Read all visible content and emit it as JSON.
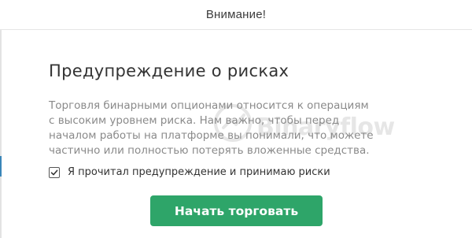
{
  "header": {
    "title": "Внимание!"
  },
  "content": {
    "heading": "Предупреждение о рисках",
    "body_lines": [
      "Торговля бинарными опционами относится к операциям",
      "с высоким уровнем риска. Нам важно, чтобы перед",
      "началом работы на платформе вы понимали, что можете",
      "частично или полностью потерять вложенные средства."
    ],
    "watermark": "Binaryflow"
  },
  "agreement": {
    "checked": true,
    "label": "Я прочитал предупреждение и принимаю риски"
  },
  "actions": {
    "start_label": "Начать торговать"
  },
  "colors": {
    "primary_button": "#2ea569",
    "heading_text": "#333333",
    "body_text": "#8a8a8a",
    "left_edge_accent": "#3a86b8"
  },
  "icons": {
    "checkbox": "check-icon",
    "watermark_logo": "binaryflow-logo-icon"
  }
}
